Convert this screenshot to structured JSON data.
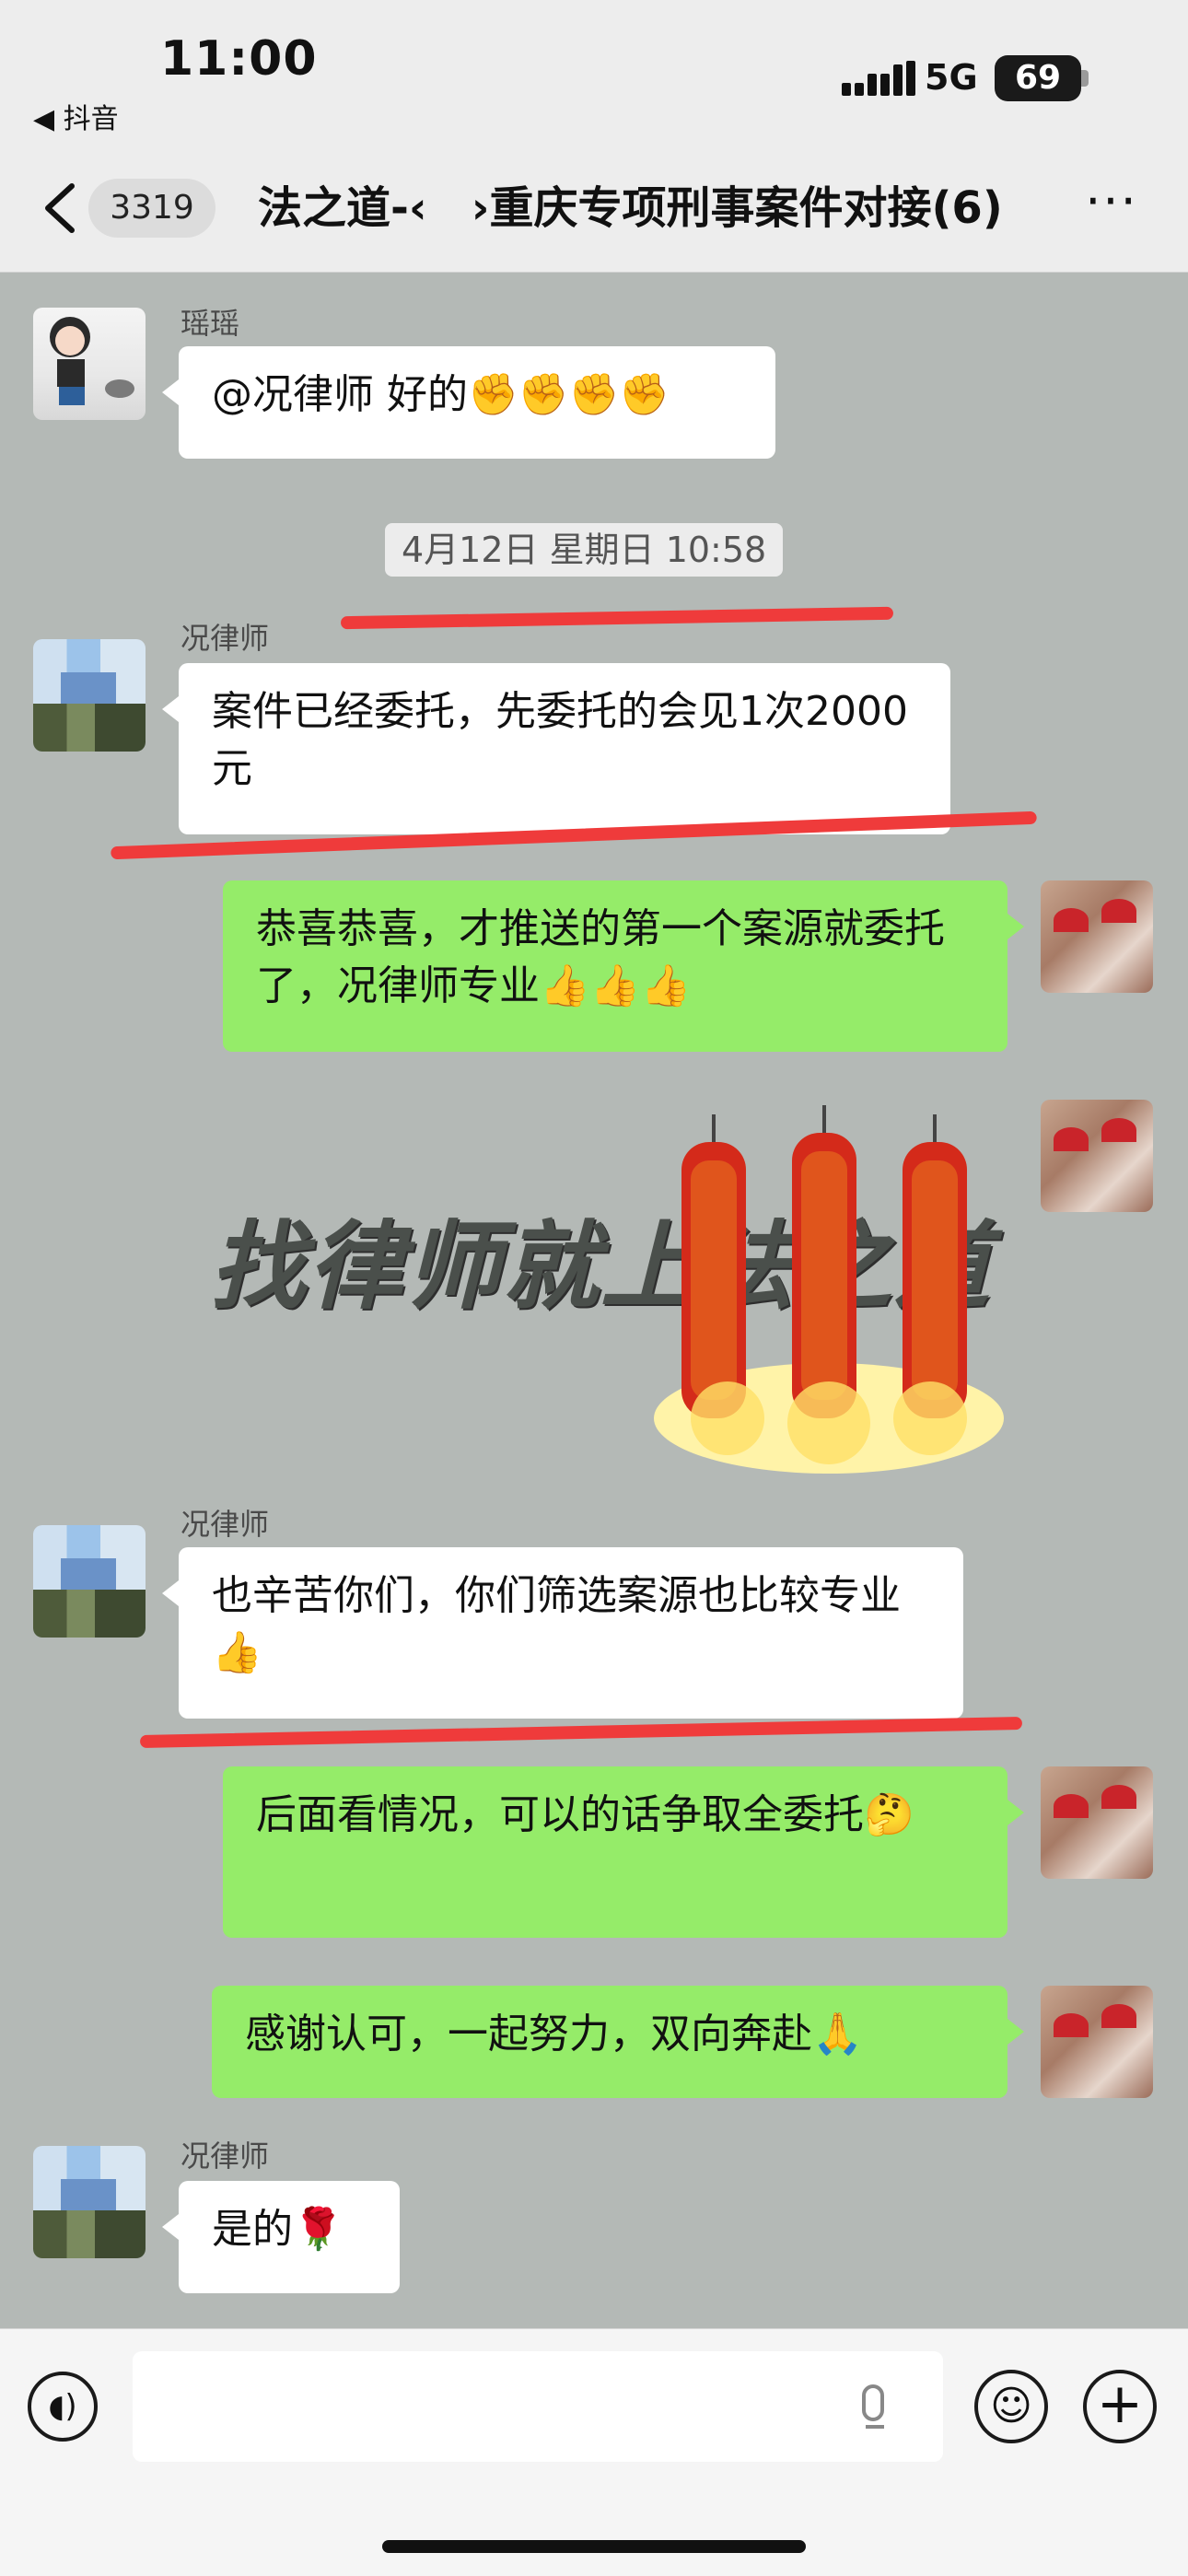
{
  "status_bar": {
    "time": "11:00",
    "back_app": "◀ 抖音",
    "network": "5G",
    "battery": "69"
  },
  "nav": {
    "unread_count": "3319",
    "title": "法之道-‹　›重庆专项刑事案件对接(6)",
    "more": "···"
  },
  "messages": [
    {
      "side": "left",
      "sender": "瑶瑶",
      "text": "@况律师 好的✊✊✊✊"
    },
    {
      "type": "timestamp",
      "text": "4月12日 星期日 10:58"
    },
    {
      "side": "left",
      "sender": "况律师",
      "text": "案件已经委托，先委托的会见1次2000元"
    },
    {
      "side": "right",
      "text": "恭喜恭喜，才推送的第一个案源就委托了，况律师专业👍👍👍"
    },
    {
      "side": "right",
      "type": "sticker",
      "text": "找律师就上法之道"
    },
    {
      "side": "left",
      "sender": "况律师",
      "text": "也辛苦你们，你们筛选案源也比较专业👍"
    },
    {
      "side": "right",
      "text": "后面看情况，可以的话争取全委托🤔"
    },
    {
      "side": "right",
      "text": "感谢认可，一起努力，双向奔赴🙏"
    },
    {
      "side": "left",
      "sender": "况律师",
      "text": "是的🌹"
    }
  ],
  "input_bar": {
    "voice_icon": "voice-icon",
    "emoji_icon": "emoji-icon",
    "plus_icon": "plus-icon"
  },
  "colors": {
    "chat_bg": "#b4b9b6",
    "bubble_self": "#95ec69",
    "bubble_other": "#ffffff",
    "annotation": "#ef3b3b"
  }
}
